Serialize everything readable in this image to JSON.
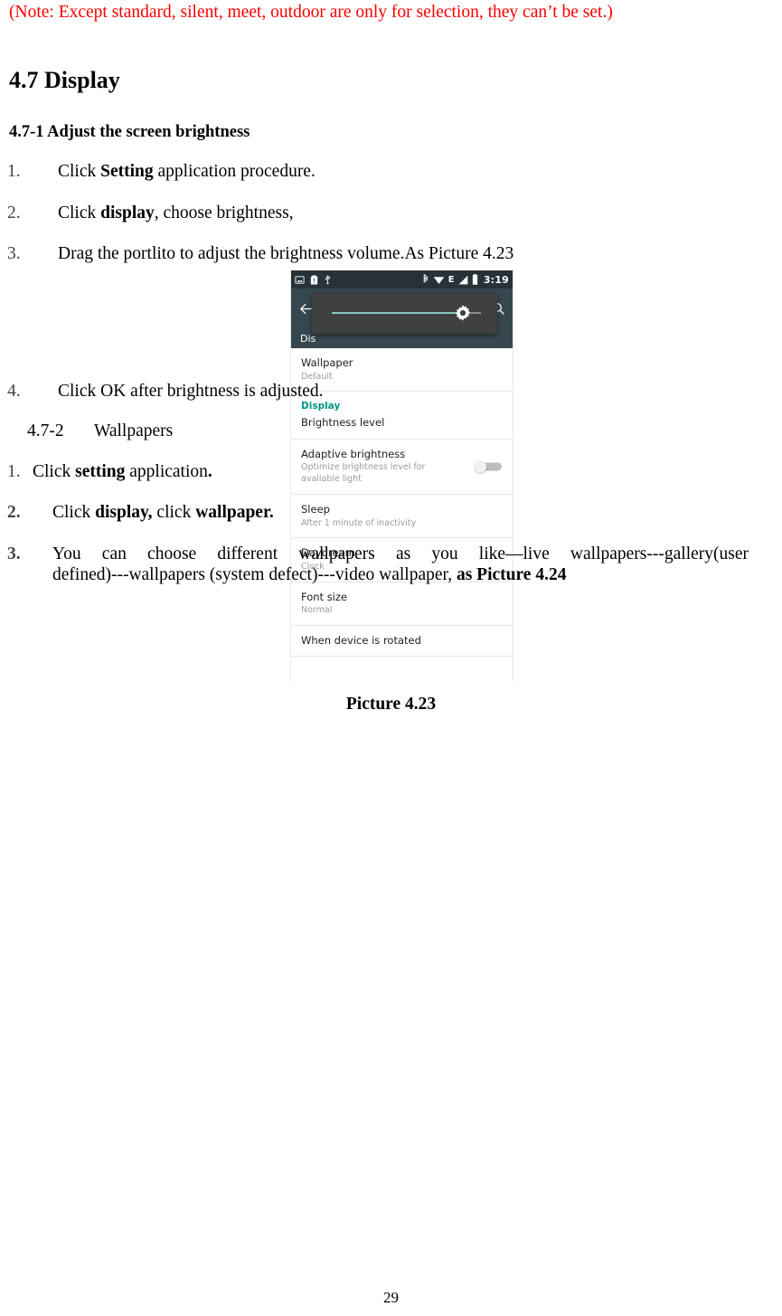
{
  "document": {
    "note": "(Note: Except standard, silent, meet, outdoor are only for selection, they can’t be set.)",
    "section_title": "4.7 Display",
    "subsection_1_title": "4.7-1 Adjust the screen brightness",
    "steps_1": [
      {
        "num": "1.",
        "pre": "Click ",
        "bold": "Setting",
        "post": " application procedure."
      },
      {
        "num": "2.",
        "pre": "Click ",
        "bold": "display",
        "post": ", choose brightness,"
      },
      {
        "num": "3.",
        "pre": "Drag the portlito to adjust the brightness volume.As Picture 4.23",
        "bold": "",
        "post": ""
      }
    ],
    "figure_caption": "Picture 4.23",
    "steps_2": [
      {
        "num": "4.",
        "pre": "Click OK after brightness is adjusted.",
        "bold": "",
        "post": ""
      }
    ],
    "subsection_2_number": "4.7-2",
    "subsection_2_title": "Wallpapers",
    "steps_3": [
      {
        "num": "1.",
        "pre": "Click ",
        "bold": "setting",
        "post": " application",
        "tail_bold": "."
      },
      {
        "num": "2.",
        "pre": "Click ",
        "bold": "display,",
        "post": " click ",
        "bold2": "wallpaper."
      },
      {
        "num": "3.",
        "line1": "You can choose different wallpapers as you like—live wallpapers---gallery(user",
        "line2_pre": "defined)---wallpapers (system defect)---video wallpaper, ",
        "line2_bold": "as Picture 4.24"
      }
    ],
    "page_number": "29"
  },
  "screenshot": {
    "statusbar": {
      "time": "3:19",
      "left_icons": [
        "image-icon",
        "sim-card-alert-icon",
        "usb-icon"
      ],
      "right_icons": [
        "bluetooth-icon",
        "wifi-icon",
        "edge-icon",
        "signal-icon",
        "battery-icon"
      ],
      "network_label": "E"
    },
    "appbar": {
      "back_icon": "back-arrow-icon",
      "title": "Display",
      "search_icon": "search-icon"
    },
    "subbar_text": "Dis",
    "brightness_panel": {
      "slider_value_percent": 88,
      "thumb_icon": "brightness-icon",
      "track_color": "#80cbc4"
    },
    "section_header": "Display",
    "rows": [
      {
        "title": "Wallpaper",
        "subtitle": "Default",
        "toggle": null
      },
      {
        "title": "Brightness level",
        "subtitle": "",
        "toggle": null
      },
      {
        "title": "Adaptive brightness",
        "subtitle": "Optimize brightness level for available light",
        "toggle": "off"
      },
      {
        "title": "Sleep",
        "subtitle": "After 1 minute of inactivity",
        "toggle": null
      },
      {
        "title": "Daydream",
        "subtitle": "Clock",
        "toggle": null
      },
      {
        "title": "Font size",
        "subtitle": "Normal",
        "toggle": null
      },
      {
        "title": "When device is rotated",
        "subtitle": "",
        "toggle": null
      }
    ],
    "colors": {
      "statusbar_bg": "#263238",
      "appbar_bg": "#37474f",
      "accent_teal": "#009688",
      "panel_bg": "#3f4040"
    }
  }
}
